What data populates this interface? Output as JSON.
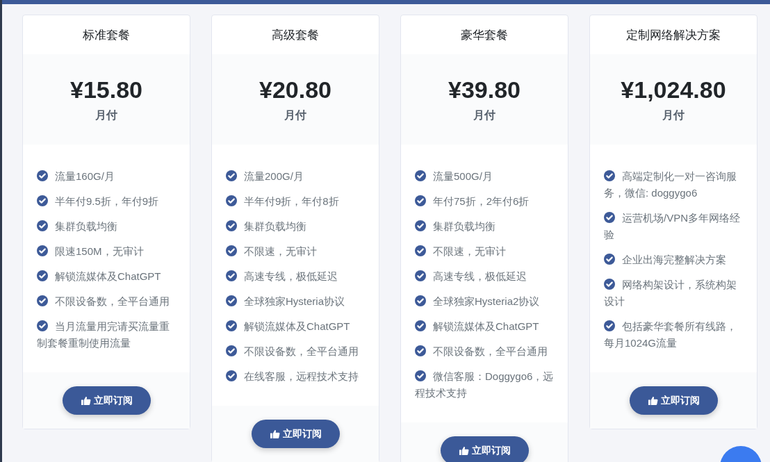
{
  "plans": [
    {
      "title": "标准套餐",
      "price": "¥15.80",
      "period": "月付",
      "features": [
        "流量160G/月",
        "半年付9.5折，年付9折",
        "集群负载均衡",
        "限速150M，无审计",
        "解锁流媒体及ChatGPT",
        "不限设备数，全平台通用",
        "当月流量用完请买流量重制套餐重制使用流量"
      ],
      "button": "立即订阅"
    },
    {
      "title": "高级套餐",
      "price": "¥20.80",
      "period": "月付",
      "features": [
        "流量200G/月",
        "半年付9折，年付8折",
        "集群负载均衡",
        "不限速，无审计",
        "高速专线，极低延迟",
        "全球独家Hysteria协议",
        "解锁流媒体及ChatGPT",
        "不限设备数，全平台通用",
        "在线客服，远程技术支持"
      ],
      "button": "立即订阅"
    },
    {
      "title": "豪华套餐",
      "price": "¥39.80",
      "period": "月付",
      "features": [
        "流量500G/月",
        "年付75折，2年付6折",
        "集群负载均衡",
        "不限速，无审计",
        "高速专线，极低延迟",
        "全球独家Hysteria2协议",
        "解锁流媒体及ChatGPT",
        "不限设备数，全平台通用",
        "微信客服：Doggygo6，远程技术支持"
      ],
      "button": "立即订阅"
    },
    {
      "title": "定制网络解决方案",
      "price": "¥1,024.80",
      "period": "月付",
      "features": [
        "高端定制化一对一咨询服务，微信: doggygo6",
        "运营机场/VPN多年网络经验",
        "企业出海完整解决方案",
        "网络构架设计，系统构架设计",
        "包括豪华套餐所有线路，每月1024G流量"
      ],
      "button": "立即订阅"
    }
  ]
}
